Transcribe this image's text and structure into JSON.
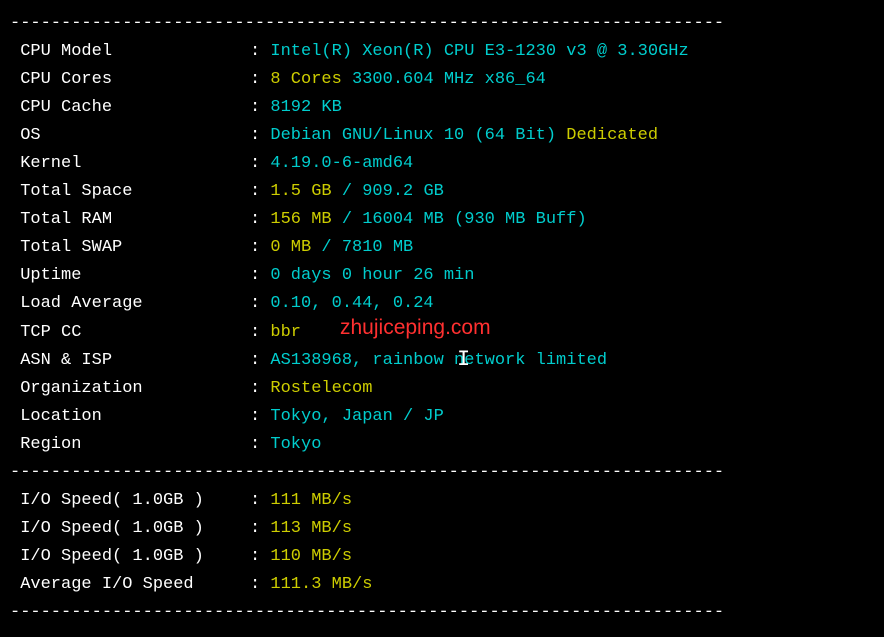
{
  "divider": "----------------------------------------------------------------------",
  "rows": [
    {
      "label": " CPU Model          ",
      "parts": [
        {
          "c": "cyan",
          "t": "Intel(R) Xeon(R) CPU E3-1230 v3 @ 3.30GHz"
        }
      ]
    },
    {
      "label": " CPU Cores          ",
      "parts": [
        {
          "c": "yellow",
          "t": "8 Cores"
        },
        {
          "c": "cyan",
          "t": " 3300.604 MHz x86_64"
        }
      ]
    },
    {
      "label": " CPU Cache          ",
      "parts": [
        {
          "c": "cyan",
          "t": "8192 KB"
        }
      ]
    },
    {
      "label": " OS                 ",
      "parts": [
        {
          "c": "cyan",
          "t": "Debian GNU/Linux 10 (64 Bit) "
        },
        {
          "c": "yellow",
          "t": "Dedicated"
        }
      ]
    },
    {
      "label": " Kernel             ",
      "parts": [
        {
          "c": "cyan",
          "t": "4.19.0-6-amd64"
        }
      ]
    },
    {
      "label": " Total Space        ",
      "parts": [
        {
          "c": "yellow",
          "t": "1.5 GB"
        },
        {
          "c": "cyan",
          "t": " / 909.2 GB"
        }
      ]
    },
    {
      "label": " Total RAM          ",
      "parts": [
        {
          "c": "yellow",
          "t": "156 MB"
        },
        {
          "c": "cyan",
          "t": " / 16004 MB (930 MB Buff)"
        }
      ]
    },
    {
      "label": " Total SWAP         ",
      "parts": [
        {
          "c": "yellow",
          "t": "0 MB"
        },
        {
          "c": "cyan",
          "t": " / 7810 MB"
        }
      ]
    },
    {
      "label": " Uptime             ",
      "parts": [
        {
          "c": "cyan",
          "t": "0 days 0 hour 26 min"
        }
      ]
    },
    {
      "label": " Load Average       ",
      "parts": [
        {
          "c": "cyan",
          "t": "0.10, 0.44, 0.24"
        }
      ]
    },
    {
      "label": " TCP CC             ",
      "parts": [
        {
          "c": "yellow",
          "t": "bbr"
        }
      ]
    },
    {
      "label": " ASN & ISP          ",
      "parts": [
        {
          "c": "cyan",
          "t": "AS138968, rainbow network limited"
        }
      ]
    },
    {
      "label": " Organization       ",
      "parts": [
        {
          "c": "yellow",
          "t": "Rostelecom"
        }
      ]
    },
    {
      "label": " Location           ",
      "parts": [
        {
          "c": "cyan",
          "t": "Tokyo, Japan / JP"
        }
      ]
    },
    {
      "label": " Region             ",
      "parts": [
        {
          "c": "cyan",
          "t": "Tokyo"
        }
      ]
    }
  ],
  "io_rows": [
    {
      "label": " I/O Speed( 1.0GB ) ",
      "parts": [
        {
          "c": "yellow",
          "t": "111 MB/s"
        }
      ]
    },
    {
      "label": " I/O Speed( 1.0GB ) ",
      "parts": [
        {
          "c": "yellow",
          "t": "113 MB/s"
        }
      ]
    },
    {
      "label": " I/O Speed( 1.0GB ) ",
      "parts": [
        {
          "c": "yellow",
          "t": "110 MB/s"
        }
      ]
    },
    {
      "label": " Average I/O Speed  ",
      "parts": [
        {
          "c": "yellow",
          "t": "111.3 MB/s"
        }
      ]
    }
  ],
  "watermark": "zhujiceping.com",
  "colors": {
    "cyan": "#00cdcd",
    "yellow": "#cdcd00",
    "white": "#ffffff",
    "bg": "#000000",
    "watermark": "#ff3030"
  }
}
